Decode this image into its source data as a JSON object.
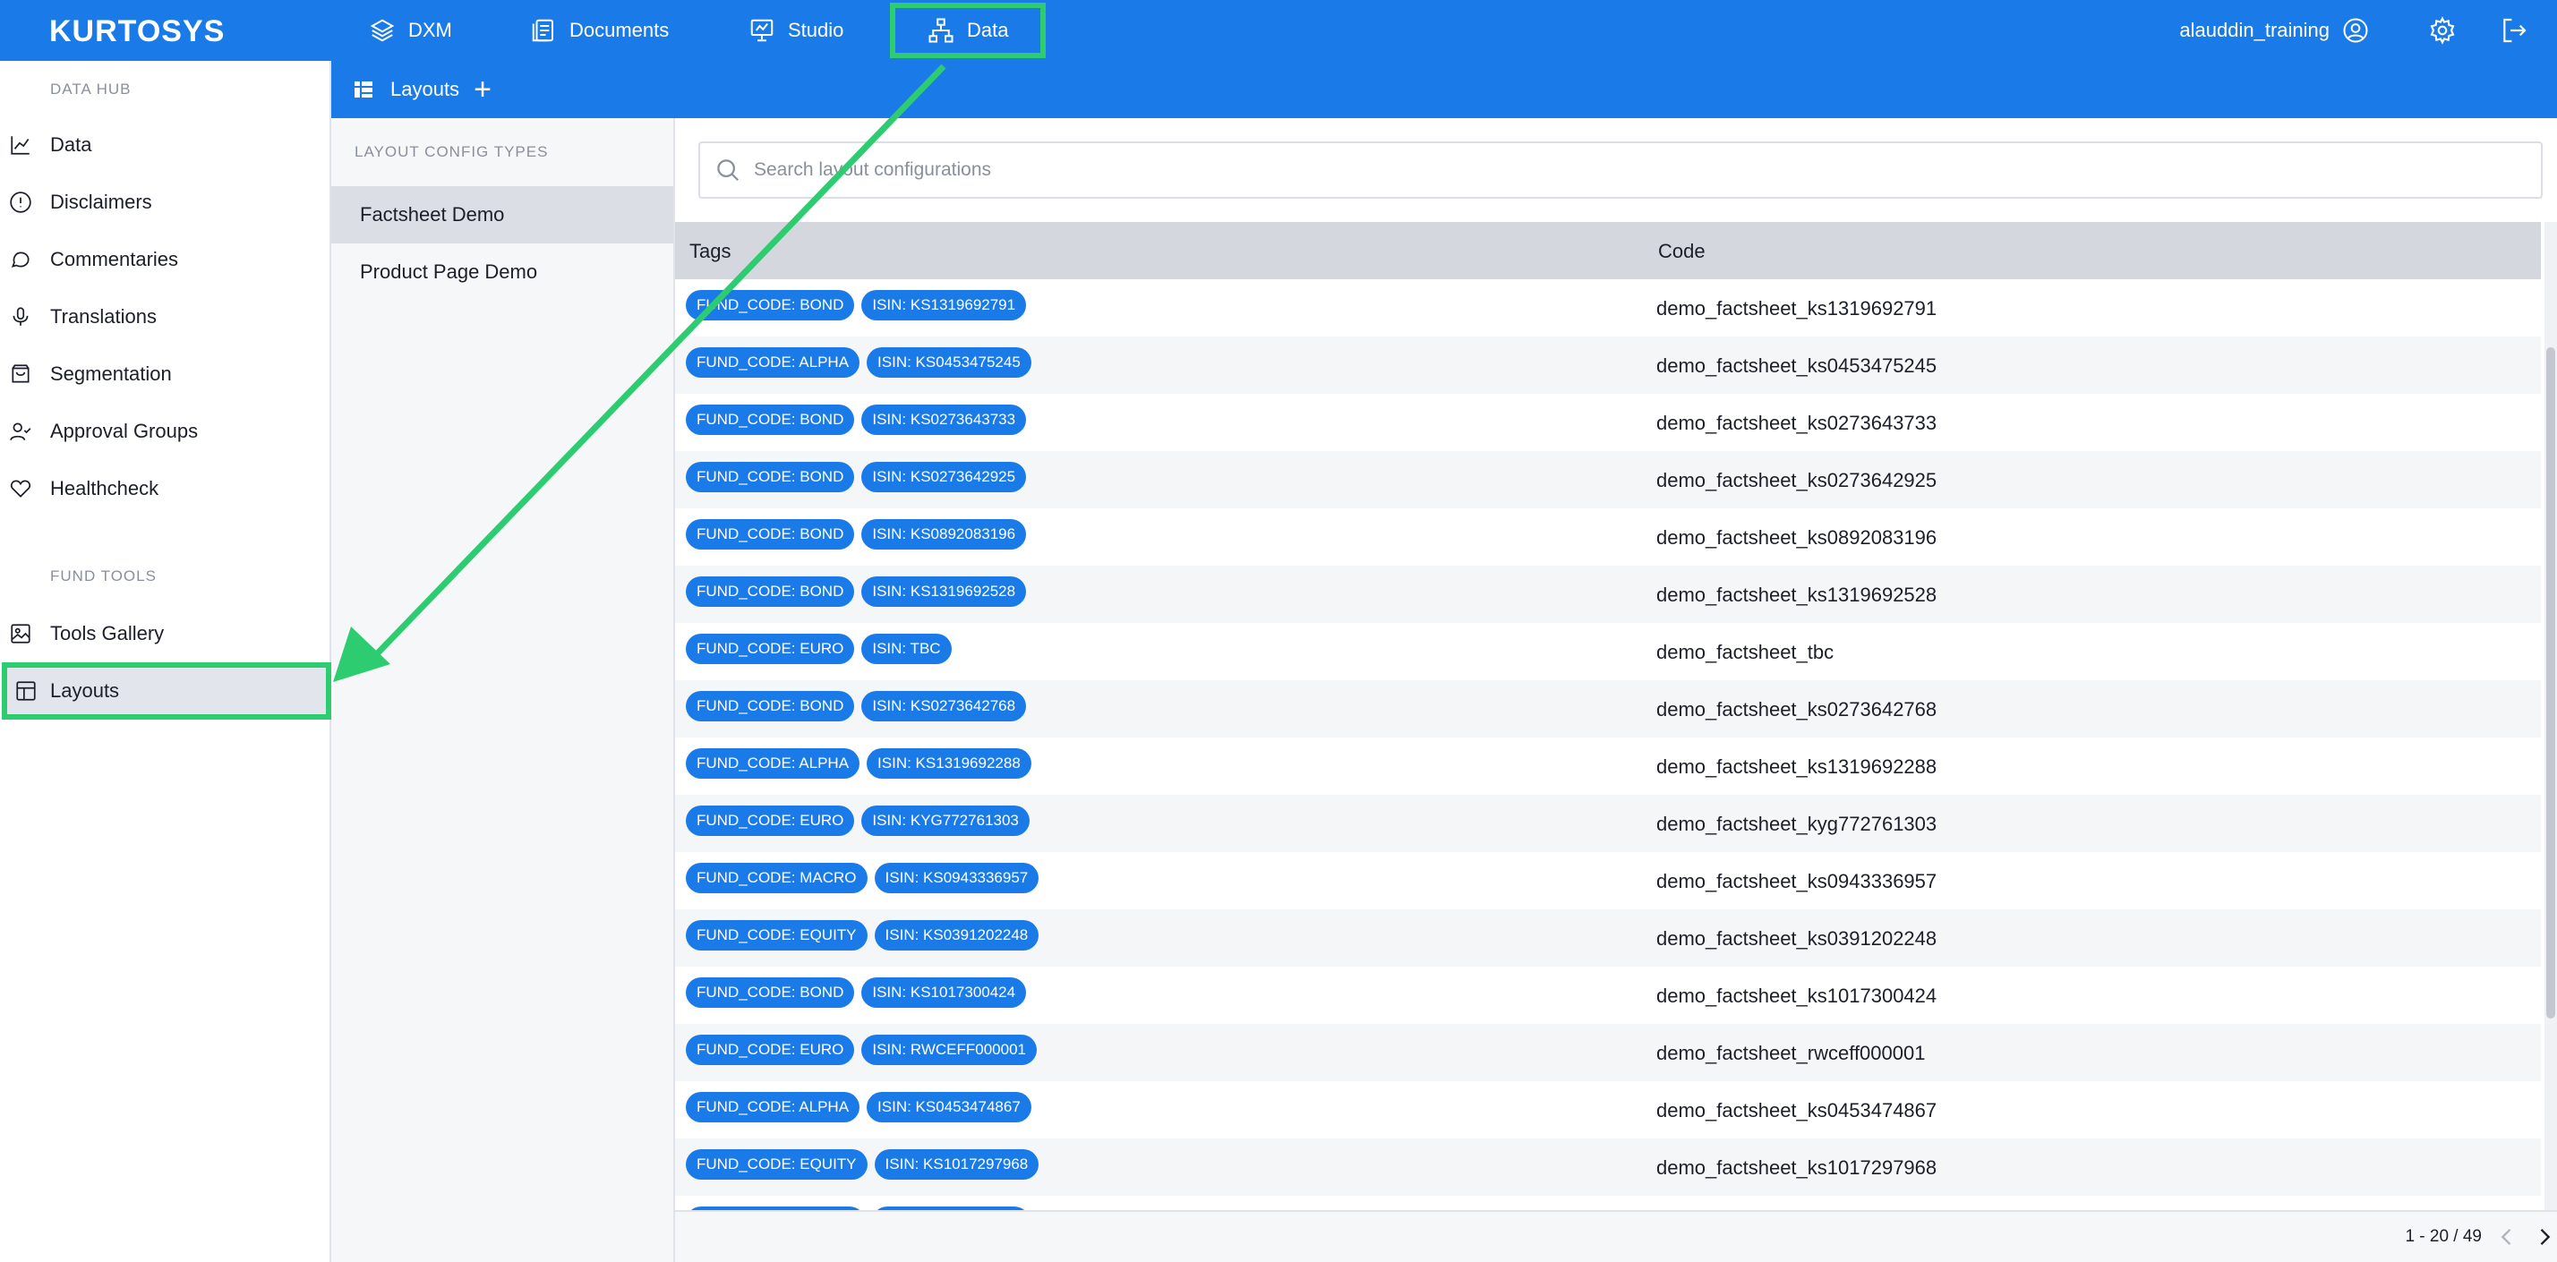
{
  "topbar": {
    "logo": "KURTOSYS",
    "nav": [
      {
        "label": "DXM",
        "icon": "layers-icon"
      },
      {
        "label": "Documents",
        "icon": "documents-icon"
      },
      {
        "label": "Studio",
        "icon": "presentation-icon"
      },
      {
        "label": "Data",
        "icon": "hierarchy-icon"
      }
    ],
    "user": "alauddin_training",
    "icons": [
      "user-circle-icon",
      "gear-icon",
      "logout-icon"
    ]
  },
  "sidebar": {
    "section1": "DATA HUB",
    "items1": [
      {
        "label": "Data",
        "icon": "chart-line-icon"
      },
      {
        "label": "Disclaimers",
        "icon": "alert-circle-icon"
      },
      {
        "label": "Commentaries",
        "icon": "speech-bubble-icon"
      },
      {
        "label": "Translations",
        "icon": "microphone-icon"
      },
      {
        "label": "Segmentation",
        "icon": "shopping-bag-icon"
      },
      {
        "label": "Approval Groups",
        "icon": "user-check-icon"
      },
      {
        "label": "Healthcheck",
        "icon": "heart-icon"
      }
    ],
    "section2": "FUND TOOLS",
    "items2": [
      {
        "label": "Tools Gallery",
        "icon": "image-icon"
      },
      {
        "label": "Layouts",
        "icon": "layout-icon"
      }
    ]
  },
  "subbar": {
    "title": "Layouts",
    "add": "+"
  },
  "types": {
    "title": "LAYOUT CONFIG TYPES",
    "items": [
      "Factsheet Demo",
      "Product Page Demo"
    ]
  },
  "search": {
    "placeholder": "Search layout configurations"
  },
  "table": {
    "headers": [
      "Tags",
      "Code"
    ],
    "rows": [
      {
        "tags": [
          "FUND_CODE: BOND",
          "ISIN: KS1319692791"
        ],
        "code": "demo_factsheet_ks1319692791"
      },
      {
        "tags": [
          "FUND_CODE: ALPHA",
          "ISIN: KS0453475245"
        ],
        "code": "demo_factsheet_ks0453475245"
      },
      {
        "tags": [
          "FUND_CODE: BOND",
          "ISIN: KS0273643733"
        ],
        "code": "demo_factsheet_ks0273643733"
      },
      {
        "tags": [
          "FUND_CODE: BOND",
          "ISIN: KS0273642925"
        ],
        "code": "demo_factsheet_ks0273642925"
      },
      {
        "tags": [
          "FUND_CODE: BOND",
          "ISIN: KS0892083196"
        ],
        "code": "demo_factsheet_ks0892083196"
      },
      {
        "tags": [
          "FUND_CODE: BOND",
          "ISIN: KS1319692528"
        ],
        "code": "demo_factsheet_ks1319692528"
      },
      {
        "tags": [
          "FUND_CODE: EURO",
          "ISIN: TBC"
        ],
        "code": "demo_factsheet_tbc"
      },
      {
        "tags": [
          "FUND_CODE: BOND",
          "ISIN: KS0273642768"
        ],
        "code": "demo_factsheet_ks0273642768"
      },
      {
        "tags": [
          "FUND_CODE: ALPHA",
          "ISIN: KS1319692288"
        ],
        "code": "demo_factsheet_ks1319692288"
      },
      {
        "tags": [
          "FUND_CODE: EURO",
          "ISIN: KYG772761303"
        ],
        "code": "demo_factsheet_kyg772761303"
      },
      {
        "tags": [
          "FUND_CODE: MACRO",
          "ISIN: KS0943336957"
        ],
        "code": "demo_factsheet_ks0943336957"
      },
      {
        "tags": [
          "FUND_CODE: EQUITY",
          "ISIN: KS0391202248"
        ],
        "code": "demo_factsheet_ks0391202248"
      },
      {
        "tags": [
          "FUND_CODE: BOND",
          "ISIN: KS1017300424"
        ],
        "code": "demo_factsheet_ks1017300424"
      },
      {
        "tags": [
          "FUND_CODE: EURO",
          "ISIN: RWCEFF000001"
        ],
        "code": "demo_factsheet_rwceff000001"
      },
      {
        "tags": [
          "FUND_CODE: ALPHA",
          "ISIN: KS0453474867"
        ],
        "code": "demo_factsheet_ks0453474867"
      },
      {
        "tags": [
          "FUND_CODE: EQUITY",
          "ISIN: KS1017297968"
        ],
        "code": "demo_factsheet_ks1017297968"
      },
      {
        "tags": [
          "",
          ""
        ],
        "code": ""
      }
    ]
  },
  "pager": {
    "range": "1 - 20 / 49"
  },
  "colors": {
    "brand": "#1a7be8",
    "highlight": "#2ecc71",
    "tag": "#1a7be8"
  }
}
